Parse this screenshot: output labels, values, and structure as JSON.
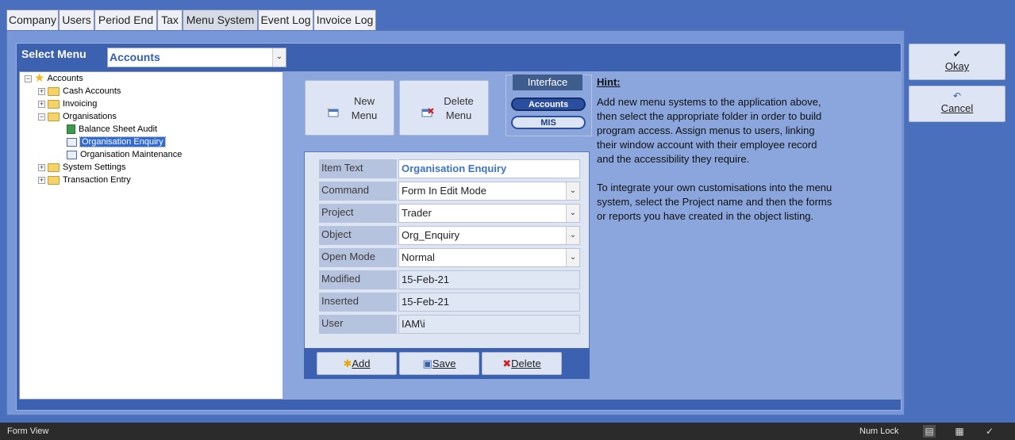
{
  "tabs": [
    "Company",
    "Users",
    "Period End",
    "Tax",
    "Menu System",
    "Event Log",
    "Invoice Log"
  ],
  "active_tab": "Menu System",
  "select_menu": {
    "label": "Select Menu",
    "value": "Accounts"
  },
  "tree": {
    "root": "Accounts",
    "nodes": [
      {
        "label": "Cash Accounts"
      },
      {
        "label": "Invoicing"
      },
      {
        "label": "Organisations"
      },
      {
        "label": "Balance Sheet Audit"
      },
      {
        "label": "Organisation Enquiry"
      },
      {
        "label": "Organisation Maintenance"
      },
      {
        "label": "System Settings"
      },
      {
        "label": "Transaction Entry"
      }
    ]
  },
  "buttons": {
    "new_menu": "New Menu",
    "delete_menu": "Delete Menu",
    "add": "Add",
    "save": "Save",
    "delete": "Delete",
    "okay": "Okay",
    "cancel": "Cancel"
  },
  "interface": {
    "title": "Interface",
    "accounts": "Accounts",
    "mis": "MIS"
  },
  "hint": {
    "title": "Hint:",
    "p1": "Add new menu systems to the application above, then select the appropriate folder in order to build program access.  Assign menus to users, linking their window account with their employee record and the accessibility they require.",
    "p2": "To integrate your own customisations into the menu system, select the Project name and then the forms or reports you have created in the object listing."
  },
  "fields": [
    {
      "label": "Item Text",
      "value": "Organisation Enquiry"
    },
    {
      "label": "Command",
      "value": "Form In Edit Mode"
    },
    {
      "label": "Project",
      "value": "Trader"
    },
    {
      "label": "Object",
      "value": "Org_Enquiry"
    },
    {
      "label": "Open Mode",
      "value": "Normal"
    },
    {
      "label": "Modified",
      "value": "15-Feb-21"
    },
    {
      "label": "Inserted",
      "value": "15-Feb-21"
    },
    {
      "label": "User",
      "value": "IAM\\i"
    }
  ],
  "status": {
    "left": "Form View",
    "num_lock": "Num Lock"
  },
  "colors": {
    "accent": "#3c61b0",
    "panel": "#8aa6dc",
    "selection": "#2f6ad6"
  }
}
